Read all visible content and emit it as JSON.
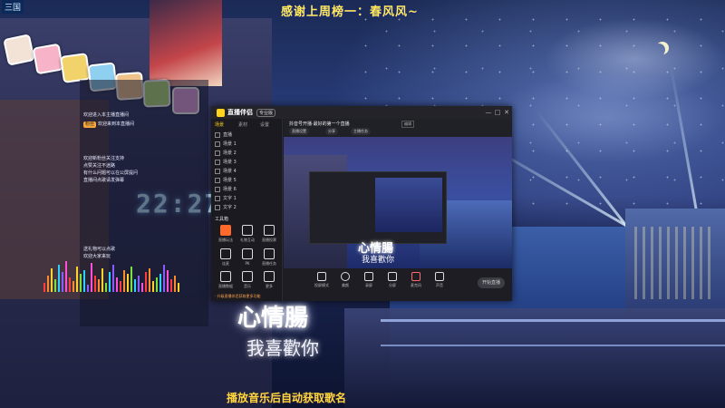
{
  "overlay": {
    "top_thanks": "感谢上周榜一：春风风~",
    "song_ticker": "播放音乐后自动获取歌名",
    "corner_logo": "三国",
    "wall_title": "心情腸",
    "wall_subtitle": "我喜歡你",
    "neon_clock": "22:27"
  },
  "chat": {
    "lines": [
      {
        "badge": "",
        "text": "欢迎进入本主播直播间"
      },
      {
        "badge": "粉丝",
        "text": "欢迎来到本直播间"
      },
      {
        "badge": "",
        "text": "欢迎新粉丝关注支持"
      },
      {
        "badge": "",
        "text": "点赞关注不迷路"
      },
      {
        "badge": "",
        "text": "有什么问题可以在公屏提问"
      },
      {
        "badge": "",
        "text": "直播间点歌请发弹幕"
      },
      {
        "badge": "",
        "text": "送礼物可以点歌"
      },
      {
        "badge": "",
        "text": "欢迎大家来玩"
      }
    ]
  },
  "app": {
    "name": "直播伴侣",
    "version": "专业版",
    "controls": {
      "minimize": "—",
      "maximize": "□",
      "close": "✕"
    },
    "sidebar": {
      "tabs": [
        {
          "label": "场景",
          "active": true
        },
        {
          "label": "素材",
          "active": false
        },
        {
          "label": "设置",
          "active": false
        }
      ],
      "scenes": [
        "直播",
        "场景 1",
        "场景 2",
        "场景 3",
        "场景 4",
        "场景 5",
        "场景 6",
        "文字 1",
        "文字 2"
      ],
      "tools_header": "工具箱",
      "tools": [
        {
          "icon": "fire-icon",
          "label": "直播玩法"
        },
        {
          "icon": "gift-icon",
          "label": "礼物互动"
        },
        {
          "icon": "vote-icon",
          "label": "直播投票"
        },
        {
          "icon": "mic-icon",
          "label": "连麦"
        },
        {
          "icon": "pk-icon",
          "label": "PK"
        },
        {
          "icon": "task-icon",
          "label": "直播任务"
        },
        {
          "icon": "data-icon",
          "label": "直播数据"
        },
        {
          "icon": "music-icon",
          "label": "音乐"
        },
        {
          "icon": "more-icon",
          "label": "更多"
        }
      ],
      "upgrade_note": "· 升级直播伴侣获取更多功能"
    },
    "header": {
      "title": "抖音号开播·最好的第一个直播",
      "edit_tag": "编辑",
      "buttons": [
        "直播设置",
        "分享",
        "主播任务"
      ]
    },
    "bottom_bar": [
      {
        "icon": "screen-icon",
        "label": "投屏模式"
      },
      {
        "icon": "beauty-icon",
        "label": "美颜"
      },
      {
        "icon": "camera-icon",
        "label": "录屏"
      },
      {
        "icon": "layout-icon",
        "label": "分屏"
      },
      {
        "icon": "mic-icon",
        "label": "麦克风"
      },
      {
        "icon": "speaker-icon",
        "label": "声音"
      }
    ],
    "go_live": "开始直播"
  },
  "colors": {
    "accent": "#ffcc1f",
    "ticker": "#ffd93b",
    "thanks": "#ffe95a"
  }
}
